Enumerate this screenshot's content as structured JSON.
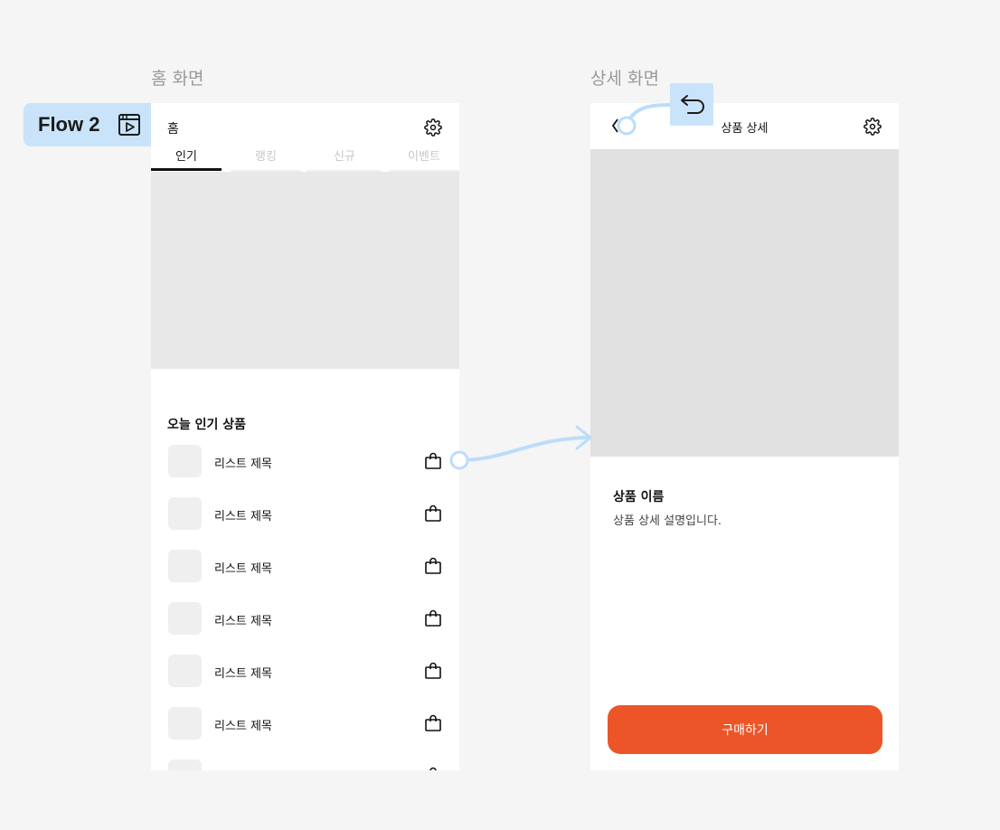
{
  "labels": {
    "home_frame": "홈 화면",
    "detail_frame": "상세 화면",
    "flow": "Flow 2"
  },
  "home": {
    "title": "홈",
    "tabs": [
      {
        "label": "인기",
        "active": true
      },
      {
        "label": "랭킹",
        "active": false
      },
      {
        "label": "신규",
        "active": false
      },
      {
        "label": "이벤트",
        "active": false
      }
    ],
    "section_title": "오늘 인기 상품",
    "items": [
      {
        "title": "리스트 제목"
      },
      {
        "title": "리스트 제목"
      },
      {
        "title": "리스트 제목"
      },
      {
        "title": "리스트 제목"
      },
      {
        "title": "리스트 제목"
      },
      {
        "title": "리스트 제목"
      },
      {
        "title": ""
      }
    ]
  },
  "detail": {
    "title": "상품 상세",
    "product_name": "상품 이름",
    "product_desc": "상품 상세 설명입니다.",
    "buy_label": "구매하기"
  },
  "colors": {
    "accent": "#ec5528",
    "flow_blue": "#c9e3fb",
    "connector": "#bcdcfb"
  },
  "icons": [
    "settings-gear-icon",
    "shopping-bag-icon",
    "chevron-left-icon",
    "flow-play-icon",
    "back-arrow-icon"
  ]
}
